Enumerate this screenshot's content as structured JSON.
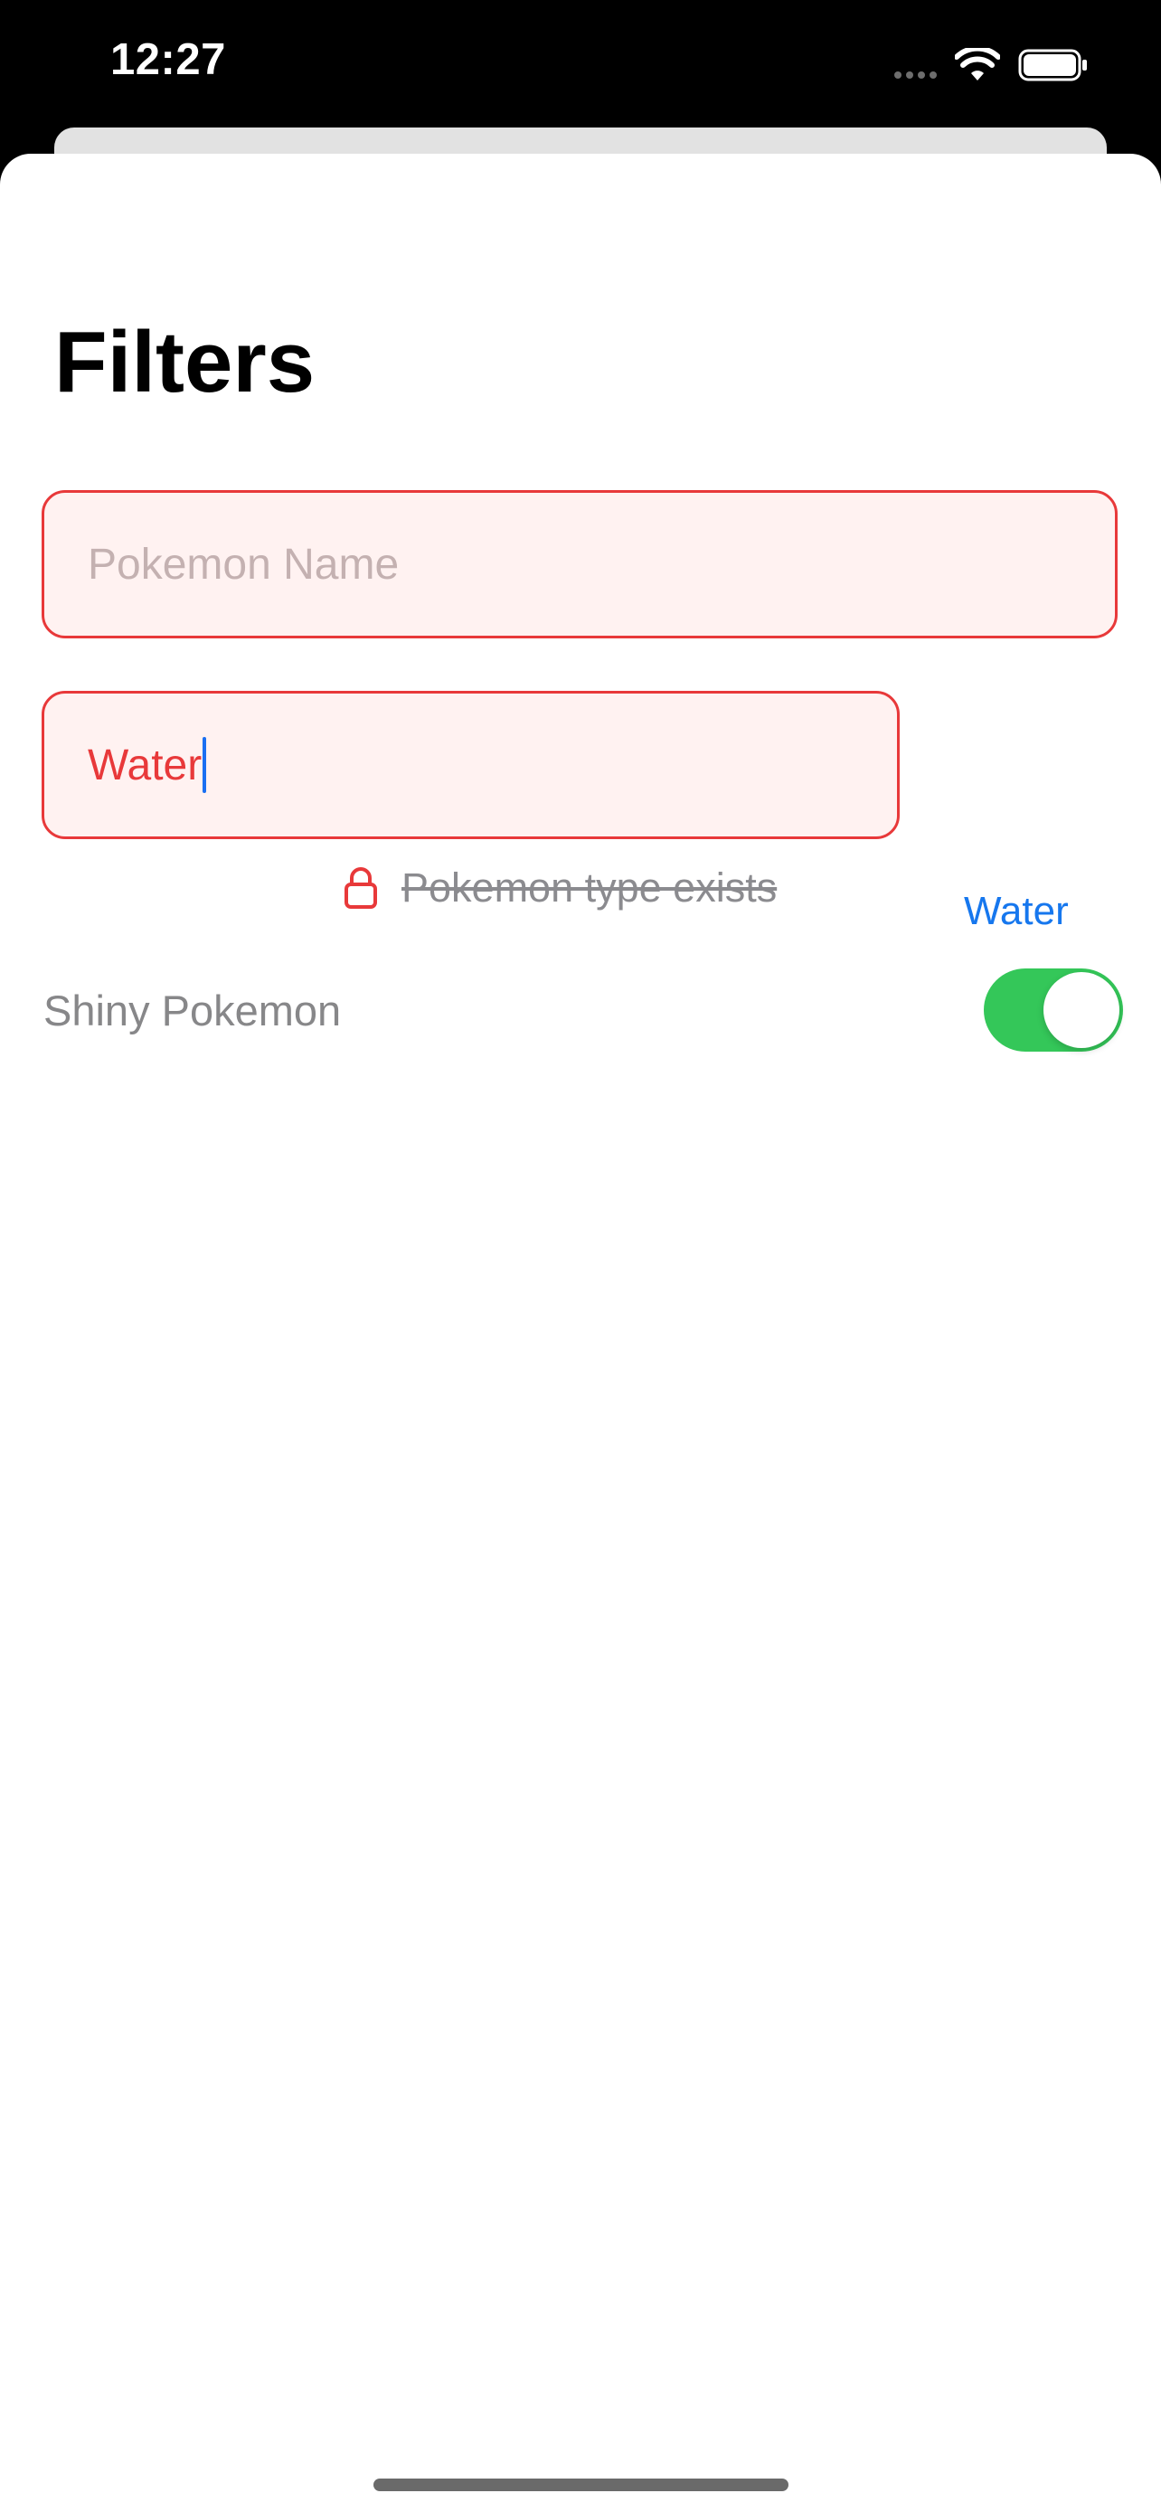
{
  "status_bar": {
    "time": "12:27",
    "icons": [
      "cellular-signal-icon",
      "wifi-icon",
      "battery-icon"
    ]
  },
  "sheet": {
    "title": "Filters",
    "name_field": {
      "value": "",
      "placeholder": "Pokemon Name"
    },
    "type_field": {
      "value": "Water",
      "placeholder": ""
    },
    "type_suggestion": "Water",
    "validation": {
      "icon": "lock-icon",
      "message": "Pokemon type exists"
    },
    "shiny_toggle": {
      "label": "Shiny Pokemon",
      "on": true
    }
  },
  "colors": {
    "error_red": "#e8393a",
    "field_bg": "#fff2f1",
    "accent_blue": "#1677ee",
    "toggle_on": "#34c759"
  }
}
